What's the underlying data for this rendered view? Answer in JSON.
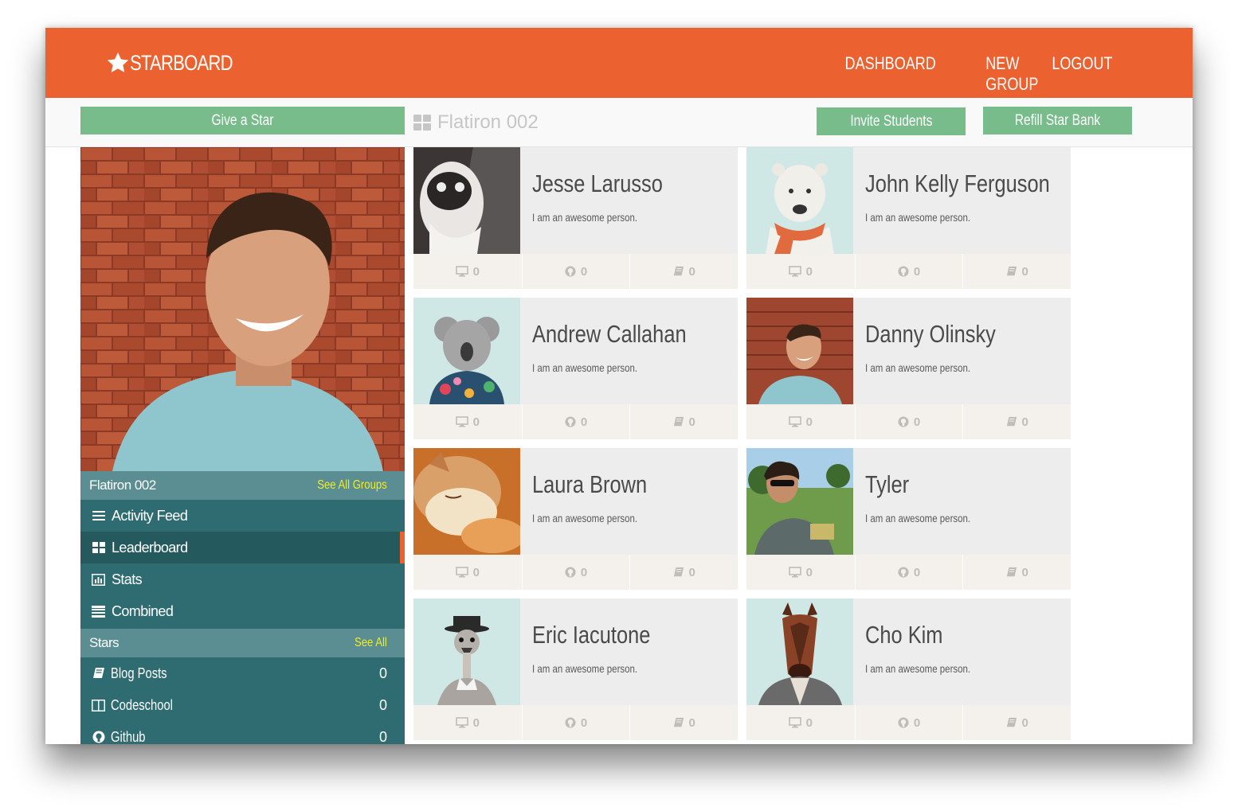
{
  "header": {
    "brand": "STARBOARD",
    "nav": [
      "DASHBOARD",
      "NEW GROUP",
      "LOGOUT"
    ]
  },
  "toolbar": {
    "give_star": "Give a Star",
    "group_title": "Flatiron 002",
    "invite": "Invite Students",
    "refill": "Refill Star Bank"
  },
  "sidebar": {
    "group_name": "Flatiron 002",
    "see_all_groups": "See All Groups",
    "menu": [
      {
        "label": "Activity Feed",
        "icon": "list-icon"
      },
      {
        "label": "Leaderboard",
        "icon": "grid-icon",
        "active": true
      },
      {
        "label": "Stats",
        "icon": "bar-chart-icon"
      },
      {
        "label": "Combined",
        "icon": "table-icon"
      }
    ],
    "stars_title": "Stars",
    "see_all": "See All",
    "stars": [
      {
        "label": "Blog Posts",
        "count": "0",
        "icon": "book-icon"
      },
      {
        "label": "Codeschool",
        "count": "0",
        "icon": "columns-icon"
      },
      {
        "label": "Github",
        "count": "0",
        "icon": "github-icon"
      }
    ]
  },
  "students": [
    {
      "name": "Jesse Larusso",
      "bio": "I am an awesome person.",
      "avatar": "monkey-illustration",
      "stats": [
        "0",
        "0",
        "0"
      ]
    },
    {
      "name": "John Kelly Ferguson",
      "bio": "I am an awesome person.",
      "avatar": "polar-bear-in-scarf",
      "stats": [
        "0",
        "0",
        "0"
      ]
    },
    {
      "name": "Andrew Callahan",
      "bio": "I am an awesome person.",
      "avatar": "koala-in-hawaiian-shirt",
      "stats": [
        "0",
        "0",
        "0"
      ]
    },
    {
      "name": "Danny Olinsky",
      "bio": "I am an awesome person.",
      "avatar": "man-by-brick-wall",
      "stats": [
        "0",
        "0",
        "0"
      ]
    },
    {
      "name": "Laura Brown",
      "bio": "I am an awesome person.",
      "avatar": "sleeping-cat",
      "stats": [
        "0",
        "0",
        "0"
      ]
    },
    {
      "name": "Tyler",
      "bio": "I am an awesome person.",
      "avatar": "man-with-sunglasses-outdoors",
      "stats": [
        "0",
        "0",
        "0"
      ]
    },
    {
      "name": "Eric Iacutone",
      "bio": "I am an awesome person.",
      "avatar": "ostrich-in-hat",
      "stats": [
        "0",
        "0",
        "0"
      ]
    },
    {
      "name": "Cho Kim",
      "bio": "I am an awesome person.",
      "avatar": "horse-in-jacket",
      "stats": [
        "0",
        "0",
        "0"
      ]
    }
  ],
  "colors": {
    "brand_orange": "#ec6130",
    "button_green": "#79bc8c",
    "sidebar_teal": "#2e6c71",
    "sidebar_header": "#5a8e92",
    "link_yellow": "#f0ec2c"
  }
}
